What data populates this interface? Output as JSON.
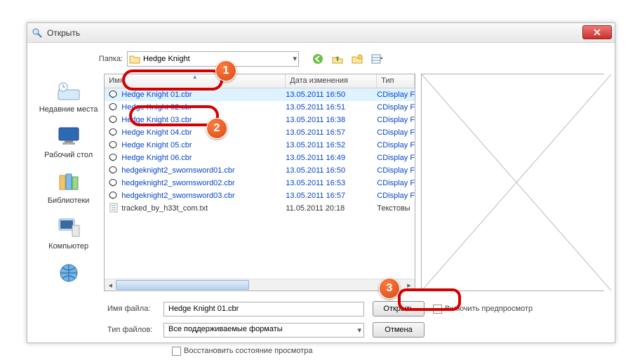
{
  "title": "Открыть",
  "folder_label": "Папка:",
  "folder_value": "Hedge Knight",
  "columns": {
    "name": "Имя",
    "date": "Дата изменения",
    "type": "Тип"
  },
  "places": [
    {
      "label": "Недавние места"
    },
    {
      "label": "Рабочий стол"
    },
    {
      "label": "Библиотеки"
    },
    {
      "label": "Компьютер"
    },
    {
      "label": ""
    }
  ],
  "files": [
    {
      "name": "Hedge Knight 01.cbr",
      "date": "13.05.2011 16:50",
      "type": "CDisplay F",
      "kind": "cbr",
      "sel": true
    },
    {
      "name": "Hedge Knight 02.cbr",
      "date": "13.05.2011 16:51",
      "type": "CDisplay F",
      "kind": "cbr"
    },
    {
      "name": "Hedge Knight 03.cbr",
      "date": "13.05.2011 16:38",
      "type": "CDisplay F",
      "kind": "cbr"
    },
    {
      "name": "Hedge Knight 04.cbr",
      "date": "13.05.2011 16:57",
      "type": "CDisplay F",
      "kind": "cbr"
    },
    {
      "name": "Hedge Knight 05.cbr",
      "date": "13.05.2011 16:52",
      "type": "CDisplay F",
      "kind": "cbr"
    },
    {
      "name": "Hedge Knight 06.cbr",
      "date": "13.05.2011 16:49",
      "type": "CDisplay F",
      "kind": "cbr"
    },
    {
      "name": "hedgeknight2_swornsword01.cbr",
      "date": "13.05.2011 16:50",
      "type": "CDisplay F",
      "kind": "cbr"
    },
    {
      "name": "hedgeknight2_swornsword02.cbr",
      "date": "13.05.2011 16:53",
      "type": "CDisplay F",
      "kind": "cbr"
    },
    {
      "name": "hedgeknight2_swornsword03.cbr",
      "date": "13.05.2011 16:57",
      "type": "CDisplay F",
      "kind": "cbr"
    },
    {
      "name": "tracked_by_h33t_com.txt",
      "date": "11.05.2011 20:18",
      "type": "Текстовы",
      "kind": "txt"
    }
  ],
  "filename_label": "Имя файла:",
  "filename_value": "Hedge Knight 01.cbr",
  "filetype_label": "Тип файлов:",
  "filetype_value": "Все поддерживаемые форматы",
  "open_btn": "Открыть",
  "cancel_btn": "Отмена",
  "preview_chk": "Включить предпросмотр",
  "restore_chk": "Восстановить состояние просмотра",
  "badges": {
    "b1": "1",
    "b2": "2",
    "b3": "3"
  }
}
